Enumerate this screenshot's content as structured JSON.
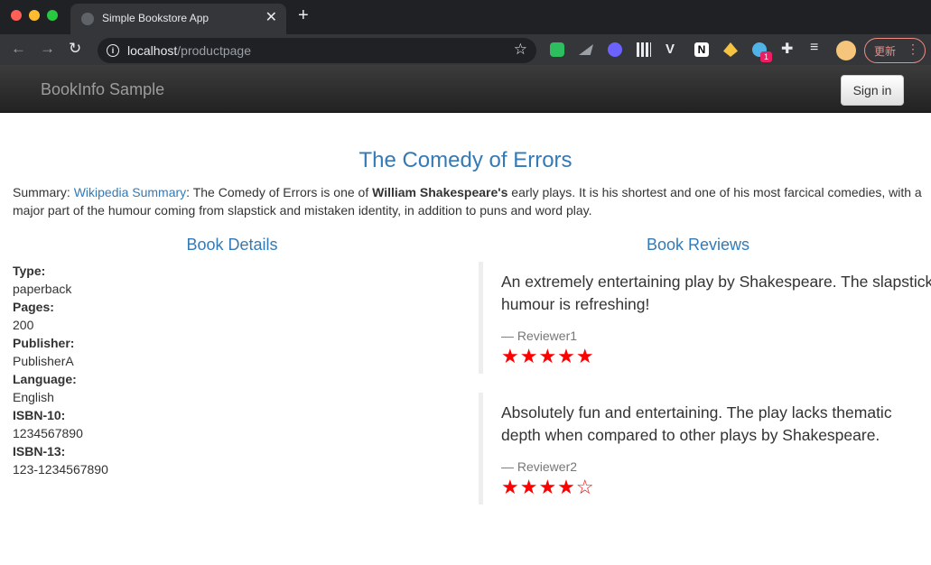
{
  "browser": {
    "tab_title": "Simple Bookstore App",
    "tab_close": "✕",
    "new_tab": "+",
    "url_host": "localhost",
    "url_path": "/productpage",
    "update_label": "更新",
    "extension_badge": "1"
  },
  "navbar": {
    "brand": "BookInfo Sample",
    "signin_label": "Sign in"
  },
  "book": {
    "title": "The Comedy of Errors",
    "summary_prefix": "Summary: ",
    "summary_link": "Wikipedia Summary",
    "summary_text_1": ": The Comedy of Errors is one of ",
    "summary_bold": "William Shakespeare's",
    "summary_text_2": " early plays. It is his shortest and one of his most farcical comedies, with a major part of the humour coming from slapstick and mistaken identity, in addition to puns and word play."
  },
  "details": {
    "heading": "Book Details",
    "items": [
      {
        "label": "Type:",
        "value": "paperback"
      },
      {
        "label": "Pages:",
        "value": "200"
      },
      {
        "label": "Publisher:",
        "value": "PublisherA"
      },
      {
        "label": "Language:",
        "value": "English"
      },
      {
        "label": "ISBN-10:",
        "value": "1234567890"
      },
      {
        "label": "ISBN-13:",
        "value": "123-1234567890"
      }
    ]
  },
  "reviews": {
    "heading": "Book Reviews",
    "items": [
      {
        "text": "An extremely entertaining play by Shakespeare. The slapstick humour is refreshing!",
        "author": "— Reviewer1",
        "rating": 5,
        "stars": "★★★★★"
      },
      {
        "text": "Absolutely fun and entertaining. The play lacks thematic depth when compared to other plays by Shakespeare.",
        "author": "— Reviewer2",
        "rating": 4,
        "stars": "★★★★☆"
      }
    ]
  }
}
